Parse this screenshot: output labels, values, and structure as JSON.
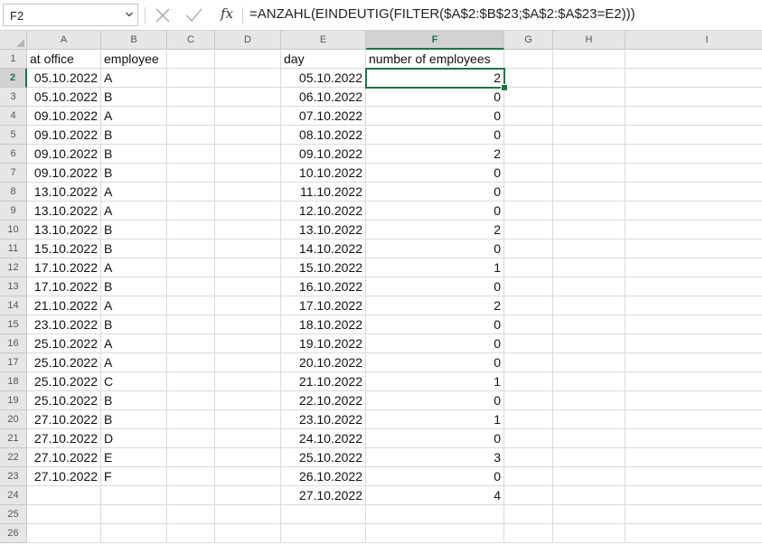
{
  "name_box": {
    "value": "F2"
  },
  "formula_bar": {
    "formula": "=ANZAHL(EINDEUTIG(FILTER($A$2:$B$23;$A$2:$A$23=E2)))",
    "fx_label": "fx"
  },
  "sheet": {
    "columns": [
      "A",
      "B",
      "C",
      "D",
      "E",
      "F",
      "G",
      "H",
      "I"
    ],
    "rows": [
      "1",
      "2",
      "3",
      "4",
      "5",
      "6",
      "7",
      "8",
      "9",
      "10",
      "11",
      "12",
      "13",
      "14",
      "15",
      "16",
      "17",
      "18",
      "19",
      "20",
      "21",
      "22",
      "23",
      "24",
      "25",
      "26"
    ],
    "selected_cell": "F2",
    "headers": {
      "a": "at office",
      "b": "employee",
      "e": "day",
      "f": "number of employees"
    },
    "col_a": [
      "05.10.2022",
      "05.10.2022",
      "09.10.2022",
      "09.10.2022",
      "09.10.2022",
      "09.10.2022",
      "13.10.2022",
      "13.10.2022",
      "13.10.2022",
      "15.10.2022",
      "17.10.2022",
      "17.10.2022",
      "21.10.2022",
      "23.10.2022",
      "25.10.2022",
      "25.10.2022",
      "25.10.2022",
      "25.10.2022",
      "27.10.2022",
      "27.10.2022",
      "27.10.2022",
      "27.10.2022"
    ],
    "col_b": [
      "A",
      "B",
      "A",
      "B",
      "B",
      "B",
      "A",
      "A",
      "B",
      "B",
      "A",
      "B",
      "A",
      "B",
      "A",
      "A",
      "C",
      "B",
      "B",
      "D",
      "E",
      "F"
    ],
    "col_e": [
      "05.10.2022",
      "06.10.2022",
      "07.10.2022",
      "08.10.2022",
      "09.10.2022",
      "10.10.2022",
      "11.10.2022",
      "12.10.2022",
      "13.10.2022",
      "14.10.2022",
      "15.10.2022",
      "16.10.2022",
      "17.10.2022",
      "18.10.2022",
      "19.10.2022",
      "20.10.2022",
      "21.10.2022",
      "22.10.2022",
      "23.10.2022",
      "24.10.2022",
      "25.10.2022",
      "26.10.2022",
      "27.10.2022"
    ],
    "col_f": [
      "2",
      "0",
      "0",
      "0",
      "2",
      "0",
      "0",
      "0",
      "2",
      "0",
      "1",
      "0",
      "2",
      "0",
      "0",
      "0",
      "1",
      "0",
      "1",
      "0",
      "3",
      "0",
      "4"
    ]
  },
  "colors": {
    "accent": "#217346",
    "header_bg": "#e6e6e6",
    "selected_header_bg": "#d2d2d2",
    "gridline": "#dadada"
  },
  "icons": {
    "name_box_arrow": "chevron-down-icon",
    "cancel": "close-icon",
    "enter": "check-icon",
    "function": "fx-icon"
  }
}
